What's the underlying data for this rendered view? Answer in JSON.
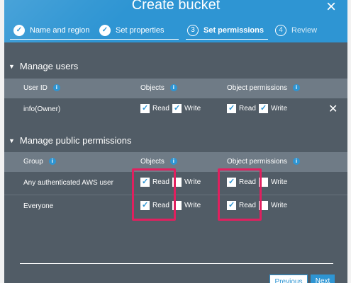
{
  "dialog": {
    "title": "Create bucket",
    "close_glyph": "×"
  },
  "steps": [
    {
      "number": "✓",
      "label": "Name and region",
      "state": "done"
    },
    {
      "number": "✓",
      "label": "Set properties",
      "state": "done"
    },
    {
      "number": "3",
      "label": "Set permissions",
      "state": "active"
    },
    {
      "number": "4",
      "label": "Review",
      "state": "pending"
    }
  ],
  "manage_users": {
    "heading": "Manage users",
    "headers": {
      "user_id": "User ID",
      "objects": "Objects",
      "object_permissions": "Object permissions"
    },
    "rows": [
      {
        "user": "info(Owner)",
        "objects_read": true,
        "objects_write": true,
        "perm_read": true,
        "perm_write": true
      }
    ],
    "remove_glyph": "✕"
  },
  "manage_public": {
    "heading": "Manage public permissions",
    "headers": {
      "group": "Group",
      "objects": "Objects",
      "object_permissions": "Object permissions"
    },
    "rows": [
      {
        "group": "Any authenticated AWS user",
        "objects_read": true,
        "objects_write": false,
        "perm_read": true,
        "perm_write": false
      },
      {
        "group": "Everyone",
        "objects_read": true,
        "objects_write": false,
        "perm_read": true,
        "perm_write": false
      }
    ]
  },
  "labels": {
    "read": "Read",
    "write": "Write",
    "info": "i"
  },
  "buttons": {
    "previous": "Previous",
    "next": "Next"
  },
  "colors": {
    "header_blue": "#2e95d3",
    "dialog_bg": "#515c66",
    "table_header": "#6f7b86",
    "highlight": "#e0205f"
  }
}
